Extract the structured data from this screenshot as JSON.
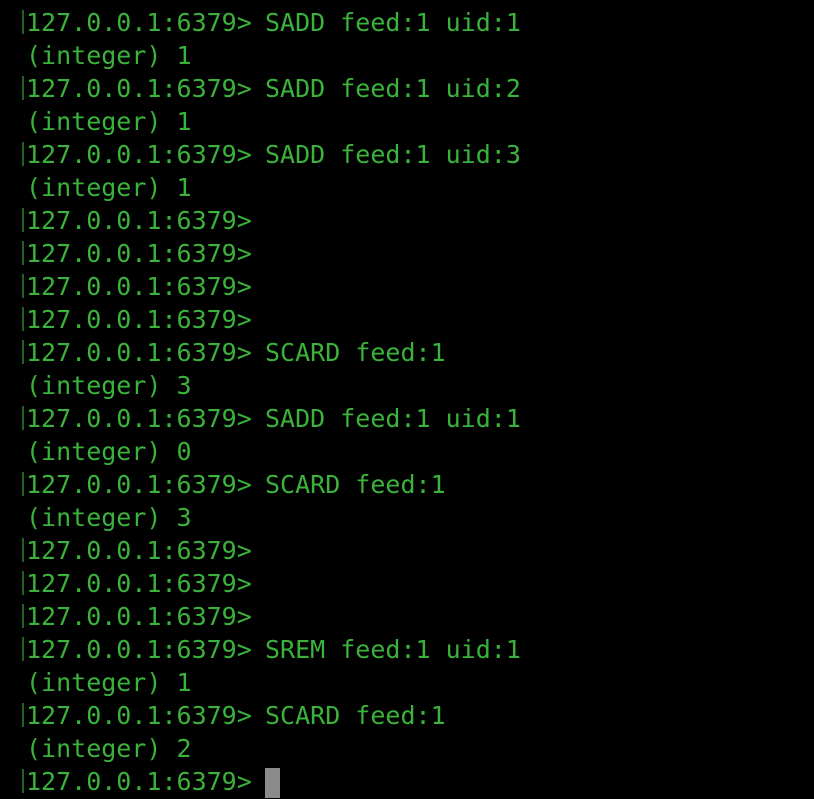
{
  "terminal": {
    "prompt": "127.0.0.1:6379>",
    "lines": [
      {
        "type": "prompt",
        "command": "SADD feed:1 uid:1"
      },
      {
        "type": "output",
        "text": "(integer) 1"
      },
      {
        "type": "prompt",
        "command": "SADD feed:1 uid:2"
      },
      {
        "type": "output",
        "text": "(integer) 1"
      },
      {
        "type": "prompt",
        "command": "SADD feed:1 uid:3"
      },
      {
        "type": "output",
        "text": "(integer) 1"
      },
      {
        "type": "prompt",
        "command": ""
      },
      {
        "type": "prompt",
        "command": ""
      },
      {
        "type": "prompt",
        "command": ""
      },
      {
        "type": "prompt",
        "command": ""
      },
      {
        "type": "prompt",
        "command": "SCARD feed:1"
      },
      {
        "type": "output",
        "text": "(integer) 3"
      },
      {
        "type": "prompt",
        "command": "SADD feed:1 uid:1"
      },
      {
        "type": "output",
        "text": "(integer) 0"
      },
      {
        "type": "prompt",
        "command": "SCARD feed:1"
      },
      {
        "type": "output",
        "text": "(integer) 3"
      },
      {
        "type": "prompt",
        "command": ""
      },
      {
        "type": "prompt",
        "command": ""
      },
      {
        "type": "prompt",
        "command": ""
      },
      {
        "type": "prompt",
        "command": "SREM feed:1 uid:1"
      },
      {
        "type": "output",
        "text": "(integer) 1"
      },
      {
        "type": "prompt",
        "command": "SCARD feed:1"
      },
      {
        "type": "output",
        "text": "(integer) 2"
      },
      {
        "type": "prompt",
        "command": "",
        "cursor": true
      }
    ],
    "colors": {
      "background": "#000000",
      "text": "#3bb23b",
      "cursor": "#8a8a8a"
    }
  }
}
